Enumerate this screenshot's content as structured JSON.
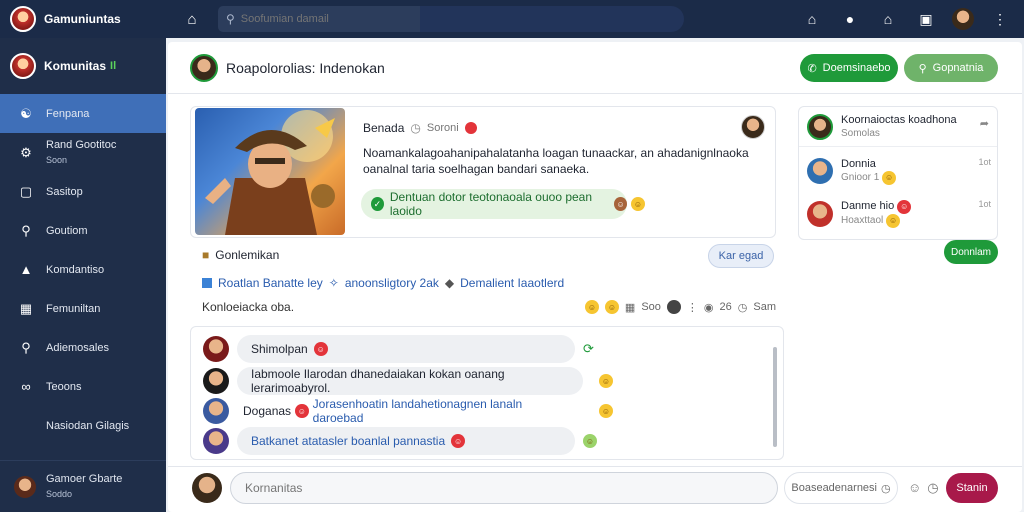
{
  "topbar": {
    "app_title": "Gamuniuntas",
    "search_placeholder": "Soofumian damail"
  },
  "sidebar": {
    "header": "Komunitas",
    "header_tag": "Il",
    "items": [
      {
        "label": "Fenpana",
        "icon": "friends-icon",
        "active": true
      },
      {
        "label": "Rand Gootitoc",
        "sub": "Soon",
        "icon": "gamepad-icon"
      },
      {
        "label": "Sasitop",
        "icon": "square-icon"
      },
      {
        "label": "Goutiom",
        "icon": "search-icon"
      },
      {
        "label": "Komdantiso",
        "icon": "megaphone-icon"
      },
      {
        "label": "Femuniltan",
        "icon": "calendar-icon"
      },
      {
        "label": "Adiemosales",
        "icon": "search-icon"
      },
      {
        "label": "Teoons",
        "icon": "link-icon"
      },
      {
        "label": "Nasiodan Gilagis",
        "icon": ""
      }
    ],
    "user": {
      "name": "Gamoer Gbarte",
      "sub": "Soddo"
    }
  },
  "main": {
    "title": "Roapolorolias: Indenokan",
    "buttons": [
      {
        "label": "Doemsinaebo",
        "icon": "phone-icon"
      },
      {
        "label": "Gopnatnia",
        "icon": "search-icon"
      }
    ],
    "post": {
      "author": "Benada",
      "time": "Soroni",
      "text": "Noamankalagoahanipahalatanha loagan tunaackar, an ahadanignlnaoka oanalnal taria soelhagan bandari sanaeka.",
      "bubble": "Dentuan dotor teotonaoala ouoo pean laoido"
    },
    "comments_header": "Gonlemikan",
    "reply_button": "Kar egad",
    "tags": [
      "Roatlan Banatte ley",
      "anoonsligtory 2ak",
      "Demalient Iaaotlerd"
    ],
    "stats": {
      "left": "Konloeiacka oba.",
      "count1": "Soo",
      "count2": "26",
      "label": "Sam"
    },
    "comments": [
      {
        "text": "Shimolpan",
        "color": "normal"
      },
      {
        "text": "Iabmoole Ilarodan dhanedaiakan kokan oanang lerarimoabyrol.",
        "color": "normal"
      },
      {
        "text": "Doganas",
        "text2": "Jorasenhoatin landahetionagnen lanaln daroebad",
        "color": "mixed"
      },
      {
        "text": "Batkanet atatasler boanlal pannastia",
        "color": "blue"
      }
    ]
  },
  "right_panel": {
    "title": "Koornaioctas koadhona",
    "sub": "Somolas",
    "rows": [
      {
        "name": "Donnia",
        "sub": "Gnioor 1",
        "time": "1ot"
      },
      {
        "name": "Danme hio",
        "sub": "Hoaxttaol",
        "time": "1ot"
      }
    ],
    "button": "Donnlam"
  },
  "composer": {
    "placeholder": "Kornanitas",
    "option": "Boaseadenarnesi",
    "send": "Stanin"
  },
  "colors": {
    "topbar": "#1b2b48",
    "sidebar": "#1f2e49",
    "sidebar_active": "#3f6fb8",
    "primary_green": "#1f9a3a",
    "send": "#a8194a"
  }
}
